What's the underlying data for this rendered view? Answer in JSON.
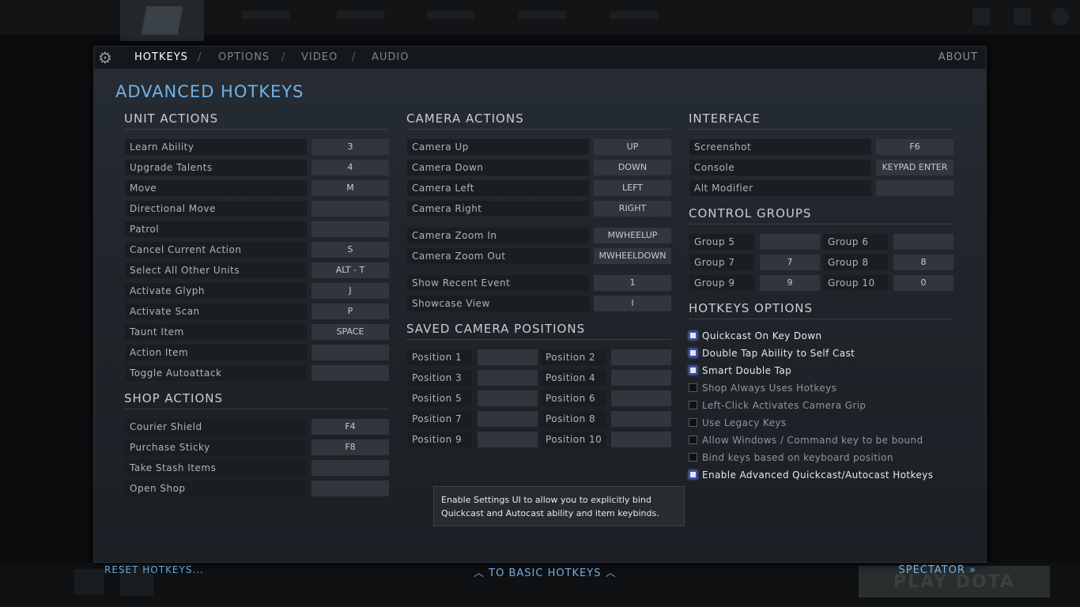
{
  "tabs": {
    "hotkeys": "HOTKEYS",
    "options": "OPTIONS",
    "video": "VIDEO",
    "audio": "AUDIO",
    "separator": "/",
    "about": "ABOUT"
  },
  "background": {
    "play_button": "PLAY DOTA"
  },
  "title": "ADVANCED HOTKEYS",
  "unit_actions": {
    "heading": "UNIT ACTIONS",
    "rows": [
      {
        "label": "Learn Ability",
        "key": "3"
      },
      {
        "label": "Upgrade Talents",
        "key": "4"
      },
      {
        "label": "Move",
        "key": "M"
      },
      {
        "label": "Directional Move",
        "key": ""
      },
      {
        "label": "Patrol",
        "key": ""
      },
      {
        "label": "Cancel Current Action",
        "key": "S"
      },
      {
        "label": "Select All Other Units",
        "key": "ALT - T"
      },
      {
        "label": "Activate Glyph",
        "key": "J"
      },
      {
        "label": "Activate Scan",
        "key": "P"
      },
      {
        "label": "Taunt Item",
        "key": "SPACE"
      },
      {
        "label": "Action Item",
        "key": ""
      },
      {
        "label": "Toggle Autoattack",
        "key": ""
      }
    ]
  },
  "shop_actions": {
    "heading": "SHOP ACTIONS",
    "rows": [
      {
        "label": "Courier Shield",
        "key": "F4"
      },
      {
        "label": "Purchase Sticky",
        "key": "F8"
      },
      {
        "label": "Take Stash Items",
        "key": ""
      },
      {
        "label": "Open Shop",
        "key": ""
      }
    ]
  },
  "camera_actions": {
    "heading": "CAMERA ACTIONS",
    "rows": [
      {
        "label": "Camera Up",
        "key": "UP"
      },
      {
        "label": "Camera Down",
        "key": "DOWN"
      },
      {
        "label": "Camera Left",
        "key": "LEFT"
      },
      {
        "label": "Camera Right",
        "key": "RIGHT"
      },
      {
        "label": "Camera Zoom In",
        "key": "MWHEELUP"
      },
      {
        "label": "Camera Zoom Out",
        "key": "MWHEELDOWN"
      },
      {
        "label": "Show Recent Event",
        "key": "1"
      },
      {
        "label": "Showcase View",
        "key": "I"
      }
    ]
  },
  "saved_camera": {
    "heading": "SAVED CAMERA POSITIONS",
    "rows": [
      {
        "label": "Position 1",
        "key": ""
      },
      {
        "label": "Position 2",
        "key": ""
      },
      {
        "label": "Position 3",
        "key": ""
      },
      {
        "label": "Position 4",
        "key": ""
      },
      {
        "label": "Position 5",
        "key": ""
      },
      {
        "label": "Position 6",
        "key": ""
      },
      {
        "label": "Position 7",
        "key": ""
      },
      {
        "label": "Position 8",
        "key": ""
      },
      {
        "label": "Position 9",
        "key": ""
      },
      {
        "label": "Position 10",
        "key": ""
      }
    ]
  },
  "interface": {
    "heading": "INTERFACE",
    "rows": [
      {
        "label": "Screenshot",
        "key": "F6"
      },
      {
        "label": "Console",
        "key": "KEYPAD ENTER"
      },
      {
        "label": "Alt Modifier",
        "key": ""
      }
    ]
  },
  "control_groups": {
    "heading": "CONTROL GROUPS",
    "rows": [
      {
        "label": "Group 5",
        "key": ""
      },
      {
        "label": "Group 6",
        "key": ""
      },
      {
        "label": "Group 7",
        "key": "7"
      },
      {
        "label": "Group 8",
        "key": "8"
      },
      {
        "label": "Group 9",
        "key": "9"
      },
      {
        "label": "Group 10",
        "key": "0"
      }
    ]
  },
  "hotkeys_options": {
    "heading": "HOTKEYS OPTIONS",
    "items": [
      {
        "label": "Quickcast On Key Down",
        "checked": true
      },
      {
        "label": "Double Tap Ability to Self Cast",
        "checked": true
      },
      {
        "label": "Smart Double Tap",
        "checked": true
      },
      {
        "label": "Shop Always Uses Hotkeys",
        "checked": false
      },
      {
        "label": "Left-Click Activates Camera Grip",
        "checked": false
      },
      {
        "label": "Use Legacy Keys",
        "checked": false
      },
      {
        "label": "Allow Windows / Command key to be bound",
        "checked": false
      },
      {
        "label": "Bind keys based on keyboard position",
        "checked": false
      },
      {
        "label": "Enable Advanced Quickcast/Autocast Hotkeys",
        "checked": true
      }
    ]
  },
  "tooltip": "Enable Settings UI to allow you to explicitly bind Quickcast and Autocast ability and item keybinds.",
  "footer": {
    "reset": "RESET HOTKEYS...",
    "basic": "TO BASIC HOTKEYS",
    "spectator": "SPECTATOR",
    "spectator_icon": "»"
  }
}
